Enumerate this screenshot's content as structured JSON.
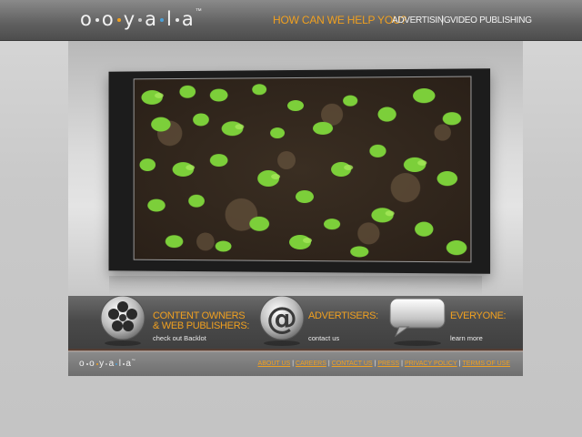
{
  "header": {
    "logo_letters": [
      "o",
      "o",
      "y",
      "a",
      "l",
      "a"
    ],
    "logo_dot_colors": [
      "#e8e8e8",
      "#f0a020",
      "#c8c8c8",
      "#4aa0d8",
      "#e8e8e8"
    ],
    "trademark": "™",
    "help_text": "HOW CAN WE HELP YOU?",
    "nav_advertising": "ADVERTISING",
    "nav_separator": "|",
    "nav_video_publishing": "VIDEO PUBLISHING"
  },
  "video": {
    "content": "seedlings growing in soil (video frame)"
  },
  "ctas": [
    {
      "title_line1": "CONTENT OWNERS",
      "title_line2": "& WEB PUBLISHERS:",
      "link": "check out Backlot",
      "icon": "film-reel-icon"
    },
    {
      "title_line1": "ADVERTISERS:",
      "title_line2": "",
      "link": "contact us",
      "icon": "at-sign-icon"
    },
    {
      "title_line1": "EVERYONE:",
      "title_line2": "",
      "link": "learn more",
      "icon": "speech-bubble-icon"
    }
  ],
  "footer": {
    "logo_letters": [
      "o",
      "o",
      "y",
      "a",
      "l",
      "a"
    ],
    "trademark": "™",
    "links": [
      "ABOUT US",
      "CAREERS",
      "CONTACT US",
      "PRESS",
      "PRIVACY POLICY",
      "TERMS OF USE"
    ],
    "separator": "|"
  },
  "colors": {
    "accent_orange": "#f0a020",
    "header_gray": "#5f5f5f",
    "band_dark": "#4a4a4a"
  }
}
